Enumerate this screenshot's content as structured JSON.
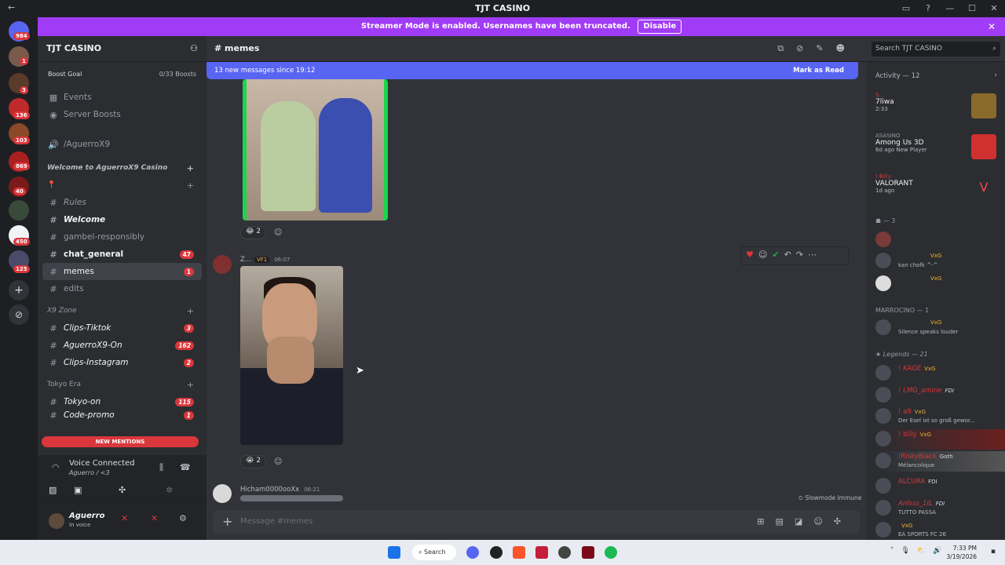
{
  "window": {
    "title": "TJT CASINO",
    "back": "←",
    "controls": [
      "▭",
      "?",
      "—",
      "☐",
      "✕"
    ]
  },
  "banner": {
    "text": "Streamer Mode is enabled. Usernames have been truncated.",
    "button": "Disable"
  },
  "guilds": {
    "badges": [
      "984",
      "1",
      "3",
      "136",
      "103",
      "869",
      "40",
      "450",
      "125"
    ]
  },
  "server": {
    "name": "TJT CASINO",
    "boost_goal": "Boost Goal",
    "boosts": "0/33 Boosts"
  },
  "channels": [
    {
      "icon": "▦",
      "label": "Events"
    },
    {
      "icon": "◉",
      "label": "Server Boosts"
    },
    {
      "icon": "🔊",
      "label": "/AguerroX9"
    }
  ],
  "categories": {
    "welcome": "Welcome to AguerroX9 Casino",
    "pin": "📍",
    "x9": "X9 Zone",
    "tokyo": "Tokyo Era"
  },
  "text_channels": [
    {
      "label": "Rules",
      "count": ""
    },
    {
      "label": "Welcome",
      "count": ""
    },
    {
      "label": "gambel-responsibly",
      "count": ""
    },
    {
      "label": "chat_general",
      "count": "47"
    },
    {
      "label": "memes",
      "count": "1"
    },
    {
      "label": "edits",
      "count": ""
    },
    {
      "label": "Clips-Tiktok",
      "count": "3"
    },
    {
      "label": "AguerroX9-On",
      "count": "162"
    },
    {
      "label": "Clips-Instagram",
      "count": "2"
    },
    {
      "label": "Tokyo-on",
      "count": "115"
    },
    {
      "label": "Code-promo",
      "count": "1"
    }
  ],
  "new_mentions": "NEW MENTIONS",
  "voice": {
    "status": "Voice Connected",
    "channel": "Aguerro / <3"
  },
  "user": {
    "name": "Aguerro",
    "status": "In voice"
  },
  "chat": {
    "channel": "memes",
    "new_messages": "13 new messages since 19:12",
    "mark_read": "Mark as Read",
    "reaction1": "😂 2",
    "msg2": {
      "user": "Z...",
      "tag": "VF1",
      "time": "06:07"
    },
    "reaction2": "😭 2",
    "msg3": {
      "user": "Hicham0000ooXx",
      "time": "06:21"
    },
    "slowmode": "Slowmode Immune",
    "placeholder": "Message #memes"
  },
  "search": {
    "placeholder": "Search TJT CASINO"
  },
  "members": {
    "activity_head": "Activity — 12",
    "activities": [
      {
        "user": "S...",
        "title": "7liwa",
        "sub": "2:33"
      },
      {
        "user": "ASASINO",
        "title": "Among Us 3D",
        "sub": "6d ago  New Player"
      },
      {
        "user": "! Billy",
        "title": "VALORANT",
        "sub": "1d ago"
      }
    ],
    "group1": "— 3",
    "group1_members": [
      {
        "name": "",
        "status": ""
      },
      {
        "name": "VxG",
        "status": "kan chofk ^-^"
      },
      {
        "name": "VxG",
        "status": ""
      }
    ],
    "group2": "MARROCINO — 1",
    "group2_members": [
      {
        "name": "VxG",
        "status": "Silence speaks louder"
      }
    ],
    "group3": "Legends — 21",
    "group3_members": [
      {
        "name": "! KAGE",
        "badge": "VxG",
        "status": ""
      },
      {
        "name": "! LMG_amine",
        "badge": "FDI",
        "status": ""
      },
      {
        "name": "! a9",
        "badge": "VxG",
        "status": "Der Esel ist so groß gewor..."
      },
      {
        "name": "! billy",
        "badge": "VxG",
        "status": ""
      },
      {
        "name": "!RiskyBlack",
        "badge": "Goth",
        "status": "Mélancolique"
      },
      {
        "name": "ALCURA",
        "badge": "FDI",
        "status": ""
      },
      {
        "name": "Anlsss_1IL",
        "badge": "FDI",
        "status": "TUTTO PASSA"
      },
      {
        "name": "",
        "badge": "VxG",
        "status": "EA SPORTS FC 26"
      }
    ]
  },
  "taskbar": {
    "search": "Search",
    "time": "7:33 PM",
    "date": "3/19/2026"
  }
}
